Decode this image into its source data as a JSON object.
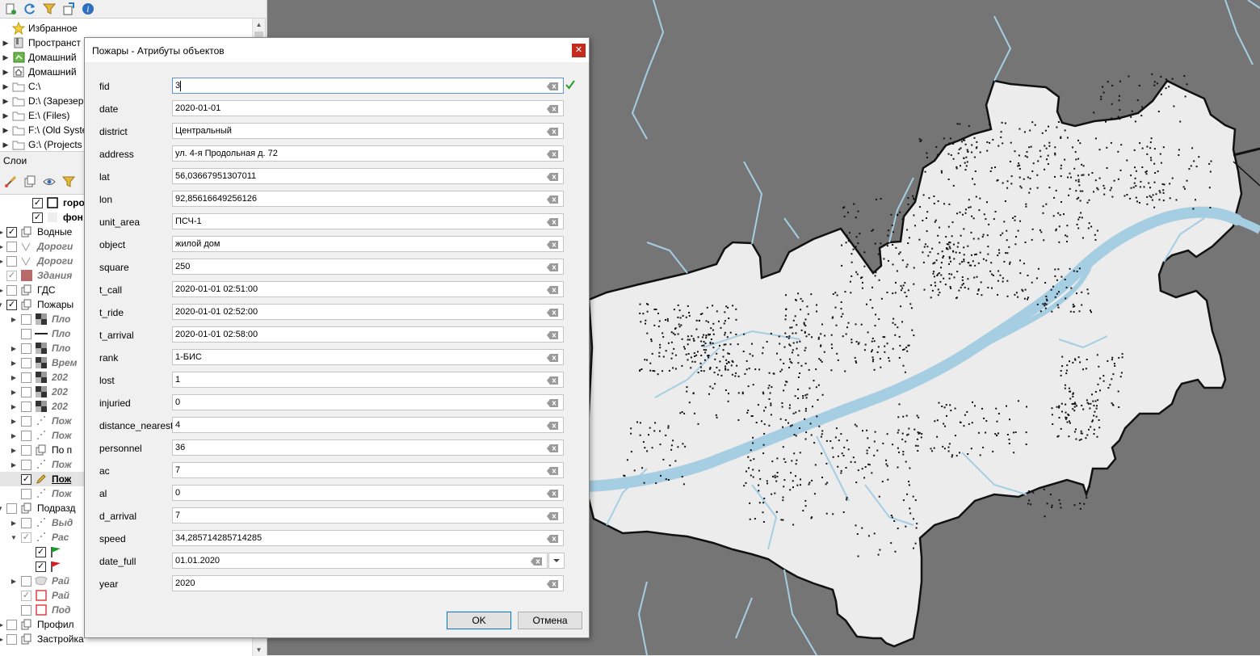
{
  "browser": {
    "items": [
      {
        "label": "Избранное",
        "icon": "star-icon"
      },
      {
        "label": "Пространст",
        "icon": "spatial-bookmark-icon"
      },
      {
        "label": "Домашний",
        "icon": "project-home-icon"
      },
      {
        "label": "Домашний",
        "icon": "home-icon"
      },
      {
        "label": "C:\\",
        "icon": "folder-icon"
      },
      {
        "label": "D:\\ (Зарезер",
        "icon": "folder-icon"
      },
      {
        "label": "E:\\ (Files)",
        "icon": "folder-icon"
      },
      {
        "label": "F:\\ (Old Syste",
        "icon": "folder-icon"
      },
      {
        "label": "G:\\ (Projects",
        "icon": "folder-icon"
      }
    ]
  },
  "layers": {
    "title": "Слои",
    "items": [
      {
        "label": "горо"
      },
      {
        "label": "фон"
      },
      {
        "label": "Водные"
      },
      {
        "label": "Дороги"
      },
      {
        "label": "Дороги"
      },
      {
        "label": "Здания"
      },
      {
        "label": "ГДС"
      },
      {
        "label": "Пожары"
      },
      {
        "label": "Пло"
      },
      {
        "label": "Пло"
      },
      {
        "label": "Пло"
      },
      {
        "label": "Врем"
      },
      {
        "label": "202"
      },
      {
        "label": "202"
      },
      {
        "label": "202"
      },
      {
        "label": "Пож"
      },
      {
        "label": "Пож"
      },
      {
        "label": "По п"
      },
      {
        "label": "Пож"
      },
      {
        "label": "Пож"
      },
      {
        "label": "Пож"
      },
      {
        "label": "Подразд"
      },
      {
        "label": "Выд"
      },
      {
        "label": "Рас"
      },
      {
        "label": ""
      },
      {
        "label": ""
      },
      {
        "label": "Рай"
      },
      {
        "label": "Рай"
      },
      {
        "label": "Под"
      },
      {
        "label": "Профил"
      },
      {
        "label": "Застройка"
      }
    ]
  },
  "dialog": {
    "title": "Пожары - Атрибуты объектов",
    "fields": [
      {
        "label": "fid",
        "value": "3"
      },
      {
        "label": "date",
        "value": "2020-01-01"
      },
      {
        "label": "district",
        "value": "Центральный"
      },
      {
        "label": "address",
        "value": " ул. 4-я Продольная  д. 72"
      },
      {
        "label": "lat",
        "value": "56,03667951307011"
      },
      {
        "label": "lon",
        "value": "92,85616649256126"
      },
      {
        "label": "unit_area",
        "value": "ПСЧ-1"
      },
      {
        "label": "object",
        "value": "жилой дом"
      },
      {
        "label": "square",
        "value": "250"
      },
      {
        "label": "t_call",
        "value": "2020-01-01 02:51:00"
      },
      {
        "label": "t_ride",
        "value": "2020-01-01 02:52:00"
      },
      {
        "label": "t_arrival",
        "value": "2020-01-01 02:58:00"
      },
      {
        "label": "rank",
        "value": "1-БИС"
      },
      {
        "label": "lost",
        "value": "1"
      },
      {
        "label": "injuried",
        "value": "0"
      },
      {
        "label": "distance_nearest",
        "value": "4"
      },
      {
        "label": "personnel",
        "value": "36"
      },
      {
        "label": "ac",
        "value": "7"
      },
      {
        "label": "al",
        "value": "0"
      },
      {
        "label": "d_arrival",
        "value": "7"
      },
      {
        "label": "speed",
        "value": "34,285714285714285"
      },
      {
        "label": "date_full",
        "value": "01.01.2020"
      },
      {
        "label": "year",
        "value": "2020"
      }
    ],
    "ok_label": "OK",
    "cancel_label": "Отмена"
  },
  "colors": {
    "map_background": "#757575",
    "city_fill": "#ececec",
    "river": "#a6cee3",
    "close_button": "#c42b1c"
  }
}
